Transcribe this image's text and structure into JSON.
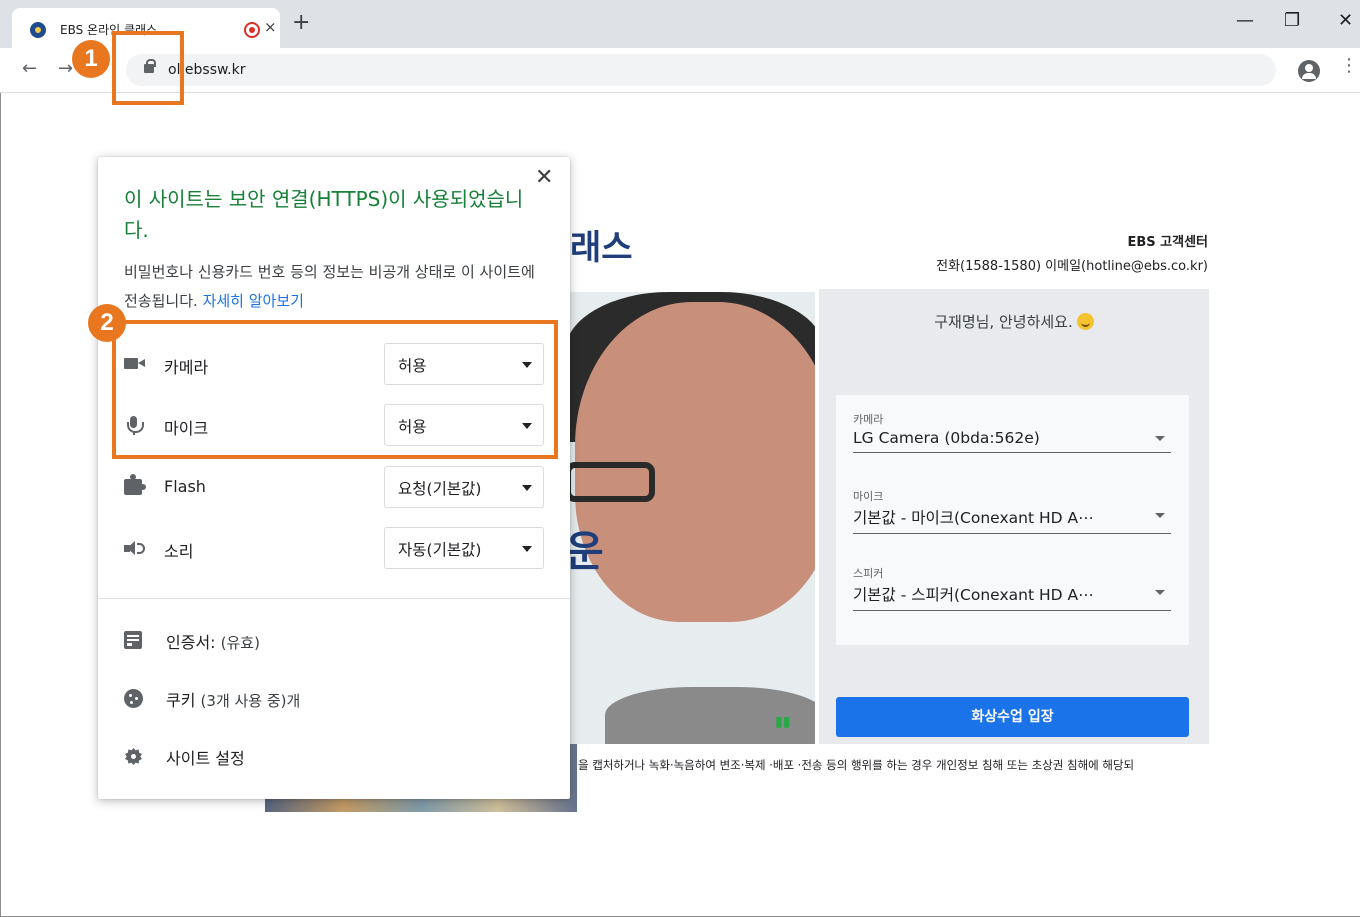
{
  "browser": {
    "tab_title": "EBS 온라인 클래스",
    "tab_close": "×",
    "new_tab": "+",
    "url": "ol.ebssw.kr",
    "window_controls": {
      "minimize": "—",
      "restore": "❐",
      "close": "✕"
    },
    "back": "←",
    "forward": "→",
    "menu": "⋮"
  },
  "site_info_popup": {
    "close": "✕",
    "title": "이 사이트는 보안 연결(HTTPS)이 사용되었습니다.",
    "description": "비밀번호나 신용카드 번호 등의 정보는 비공개 상태로 이 사이트에 전송됩니다.",
    "learn_more": "자세히 알아보기",
    "permissions": [
      {
        "icon": "camera-icon",
        "label": "카메라",
        "value": "허용"
      },
      {
        "icon": "microphone-icon",
        "label": "마이크",
        "value": "허용"
      },
      {
        "icon": "puzzle-icon",
        "label": "Flash",
        "value": "요청(기본값)"
      },
      {
        "icon": "speaker-icon",
        "label": "소리",
        "value": "자동(기본값)"
      }
    ],
    "links": [
      {
        "icon": "certificate-icon",
        "label": "인증서:",
        "sub": "(유효)"
      },
      {
        "icon": "cookie-icon",
        "label": "쿠키",
        "sub": "(3개 사용 중)개"
      },
      {
        "icon": "gear-icon",
        "label": "사이트 설정",
        "sub": ""
      }
    ]
  },
  "page": {
    "brand_fragment": "래스",
    "side_glyph": "운",
    "customer_center_title": "EBS 고객센터",
    "customer_center_contact": "전화(1588-1580) 이메일(hotline@ebs.co.kr)",
    "greeting": "구재명님, 안녕하세요.",
    "devices": [
      {
        "label": "카메라",
        "value": "LG Camera (0bda:562e)"
      },
      {
        "label": "마이크",
        "value": "기본값 - 마이크(Conexant HD A⋯"
      },
      {
        "label": "스피커",
        "value": "기본값 - 스피커(Conexant HD A⋯"
      }
    ],
    "enter_button": "화상수업 입장",
    "notice": "을 캡처하거나 녹화·녹음하여 변조·복제 ·배포 ·전송 등의 행위를 하는 경우 개인정보 침해 또는 초상권 침해에 해당되"
  },
  "annotations": {
    "badge_1": "1",
    "badge_2": "2",
    "accent_color": "#e8771f"
  }
}
